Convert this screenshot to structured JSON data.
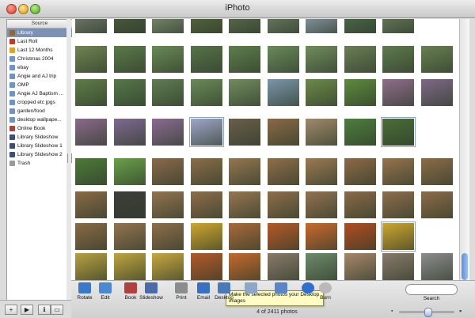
{
  "window": {
    "title": "iPhoto"
  },
  "source": {
    "header": "Source",
    "items": [
      {
        "label": "Library",
        "icon": "library-icon",
        "color": "#8a6a3a",
        "selected": true
      },
      {
        "label": "Last Roll",
        "icon": "last-roll-icon",
        "color": "#c0392b"
      },
      {
        "label": "Last 12 Months",
        "icon": "calendar-icon",
        "color": "#d9a52f"
      },
      {
        "label": "Christmas 2004",
        "icon": "album-icon",
        "color": "#6f93c9"
      },
      {
        "label": "ebay",
        "icon": "album-icon",
        "color": "#6f93c9"
      },
      {
        "label": "Angie and AJ trip",
        "icon": "album-icon",
        "color": "#6f93c9"
      },
      {
        "label": "OMP",
        "icon": "album-icon",
        "color": "#6f93c9"
      },
      {
        "label": "Angie AJ Baptism ...",
        "icon": "album-icon",
        "color": "#6f93c9"
      },
      {
        "label": "cropped etc jpgs",
        "icon": "album-icon",
        "color": "#6f93c9"
      },
      {
        "label": "garden/food",
        "icon": "album-icon",
        "color": "#6f93c9"
      },
      {
        "label": "desktop wallpape...",
        "icon": "album-icon",
        "color": "#6f93c9"
      },
      {
        "label": "Online Book",
        "icon": "book-icon",
        "color": "#b0413e"
      },
      {
        "label": "Library Slideshow",
        "icon": "slideshow-icon",
        "color": "#3d4f78"
      },
      {
        "label": "Library Slideshow 1",
        "icon": "slideshow-icon",
        "color": "#3d4f78"
      },
      {
        "label": "Library Slideshow 2",
        "icon": "slideshow-icon",
        "color": "#3d4f78"
      },
      {
        "label": "Trash",
        "icon": "trash-icon",
        "color": "#9a9a9a"
      }
    ]
  },
  "toolbar": {
    "tools": [
      {
        "label": "Rotate",
        "icon": "rotate-icon",
        "color": "#3c78c8"
      },
      {
        "label": "Edit",
        "icon": "edit-icon",
        "color": "#4a88d0"
      },
      {
        "label": "Book",
        "icon": "book-icon",
        "color": "#b0413e"
      },
      {
        "label": "Slideshow",
        "icon": "slideshow-icon",
        "color": "#4a6aa8"
      },
      {
        "label": "Print",
        "icon": "print-icon",
        "color": "#8c8c8c"
      },
      {
        "label": "Email",
        "icon": "email-icon",
        "color": "#3a70c0"
      },
      {
        "label": "Desktop",
        "icon": "desktop-icon",
        "color": "#4a78b8"
      },
      {
        "label": "",
        "icon": "homepage-icon",
        "color": "#8fa7c7"
      },
      {
        "label": "",
        "icon": "dotmac-icon",
        "color": "#5a86c8"
      },
      {
        "label": "",
        "icon": "globe-icon",
        "color": "#2e6fd0"
      },
      {
        "label": "Burn",
        "icon": "burn-icon",
        "color": "#b9b9b9"
      }
    ],
    "tooltip": "Make the selected photos your Desktop images",
    "count": "4 of 2411 photos",
    "search_label": "Search"
  },
  "bottom_left": {
    "buttons": [
      "+",
      "▶",
      "ℹ",
      "▭"
    ]
  },
  "scroll": {
    "position": 0.92
  },
  "photos": {
    "rows": [
      [
        "#707a6a",
        "#4a5a3e",
        "#7c8b70",
        "#55663d",
        "#5a6a4a",
        "#6a7a60",
        "#8a9aa8",
        "#4a6a48",
        "#667a5a"
      ],
      [
        "#6f8452",
        "#5c7a4a",
        "#6a8a56",
        "#56744a",
        "#5e7e4c",
        "#6a8a5a",
        "#708c5c",
        "#6a7e56",
        "#5e7a4e",
        "#668052"
      ],
      [
        "#5e7e48",
        "#56784a",
        "#5f7d52",
        "#6a8a58",
        "#708c5e",
        "#7a96a8",
        "#6c8a4a",
        "#5e8a3e",
        "#8e6e8a",
        "#7e6a86"
      ],
      [
        "#8a6a8c",
        "#7e6a90",
        "#8a6c92",
        "#9ea6c8",
        "#6a5e4a",
        "#8a6a46",
        "#a08a6a",
        "#4e7e3e",
        "#4a6e38"
      ],
      [
        "#4e7a3a",
        "#6aa04a",
        "#8a6a4a",
        "#8a6e48",
        "#947650",
        "#8e6e4a",
        "#9a7a52",
        "#8c6a46",
        "#96744e",
        "#8c6c48"
      ],
      [
        "#8a6a46",
        "#3e3e3a",
        "#947450",
        "#8e6e4a",
        "#967650",
        "#8e6e4a",
        "#927250",
        "#8a6a48",
        "#8e6e4c",
        "#8c6c48"
      ],
      [
        "#8a6a46",
        "#947450",
        "#8e6e4a",
        "#cfa62e",
        "#a86a3a",
        "#b45a28",
        "#c86a2e",
        "#b04e22",
        "#cfa62e"
      ],
      [
        "#b8a040",
        "#c0a43e",
        "#c8a83e",
        "#b45a28",
        "#c46a2c",
        "#8a7a6a",
        "#6e8a6a",
        "#a8866a",
        "#8a7a6a",
        "#8c8c8c"
      ]
    ]
  }
}
